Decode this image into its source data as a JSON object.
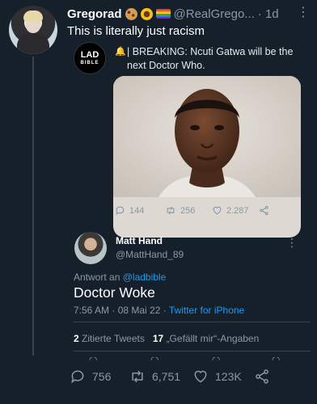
{
  "tweet": {
    "display_name": "Gregorad",
    "handle": "@RealGrego...",
    "time": "· 1d",
    "text": "This is literally just racism",
    "emojis": [
      "cookie-icon",
      "sunflower-icon",
      "rainbow-flag-icon"
    ]
  },
  "quoted": {
    "avatar_text": "LAD",
    "avatar_subtext": "BIBLE",
    "text": "| BREAKING: Ncuti Gatwa will be the next Doctor Who.",
    "replies": "144",
    "retweets": "256",
    "likes": "2.287"
  },
  "reply": {
    "name": "Matt Hand",
    "handle": "@MattHand_89",
    "reply_to_label": "Antwort an",
    "reply_to_handle": "@ladbible",
    "text": "Doctor Woke",
    "timestamp": "7:56 AM · 08 Mai 22 ·",
    "source": "Twitter for iPhone",
    "quote_count": "2",
    "quote_label": "Zitierte Tweets",
    "like_count": "17",
    "like_label": "„Gefällt mir“-Angaben"
  },
  "actions": {
    "replies": "756",
    "retweets": "6,751",
    "likes": "123K"
  },
  "colors": {
    "background": "#15202b",
    "muted": "#8b98a5",
    "accent": "#1d9bf0"
  }
}
